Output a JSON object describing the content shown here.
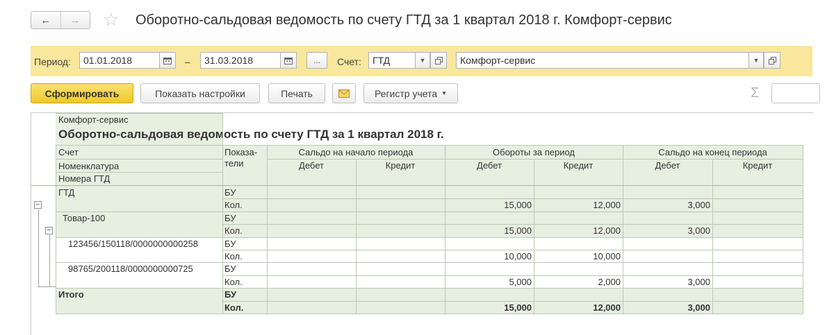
{
  "header": {
    "back_icon": "←",
    "forward_icon": "→",
    "star_icon": "☆",
    "title": "Оборотно-сальдовая ведомость по счету ГТД за 1 квартал 2018 г. Комфорт-сервис"
  },
  "params": {
    "period_label": "Период:",
    "date_from": "01.01.2018",
    "dash": "–",
    "date_to": "31.03.2018",
    "ellipsis": "...",
    "account_label": "Счет:",
    "account_value": "ГТД",
    "org_value": "Комфорт-сервис"
  },
  "toolbar": {
    "generate": "Сформировать",
    "show_settings": "Показать настройки",
    "print": "Печать",
    "register": "Регистр учета",
    "sigma": "Σ"
  },
  "report": {
    "org": "Комфорт-сервис",
    "title": "Оборотно-сальдовая ведомость по счету ГТД за 1 квартал 2018 г.",
    "head": {
      "account": "Счет",
      "nomenclature": "Номенклатура",
      "gtd_numbers": "Номера ГТД",
      "indicators_1": "Показа-",
      "indicators_2": "тели",
      "opening": "Сальдо на начало периода",
      "turnover": "Обороты за период",
      "closing": "Сальдо на конец периода",
      "debit": "Дебет",
      "credit": "Кредит"
    },
    "rows": [
      {
        "label": "ГТД",
        "ind": "БУ",
        "v": [
          "",
          "",
          "",
          "",
          "",
          ""
        ]
      },
      {
        "label": "",
        "ind": "Кол.",
        "v": [
          "",
          "",
          "15,000",
          "12,000",
          "3,000",
          ""
        ]
      },
      {
        "label": "Товар-100",
        "ind": "БУ",
        "v": [
          "",
          "",
          "",
          "",
          "",
          ""
        ]
      },
      {
        "label": "",
        "ind": "Кол.",
        "v": [
          "",
          "",
          "15,000",
          "12,000",
          "3,000",
          ""
        ]
      },
      {
        "label": "123456/150118/0000000000258",
        "ind": "БУ",
        "v": [
          "",
          "",
          "",
          "",
          "",
          ""
        ]
      },
      {
        "label": "",
        "ind": "Кол.",
        "v": [
          "",
          "",
          "10,000",
          "10,000",
          "",
          ""
        ]
      },
      {
        "label": "98765/200118/0000000000725",
        "ind": "БУ",
        "v": [
          "",
          "",
          "",
          "",
          "",
          ""
        ]
      },
      {
        "label": "",
        "ind": "Кол.",
        "v": [
          "",
          "",
          "5,000",
          "2,000",
          "3,000",
          ""
        ]
      },
      {
        "label": "Итого",
        "ind": "БУ",
        "v": [
          "",
          "",
          "",
          "",
          "",
          ""
        ]
      },
      {
        "label": "",
        "ind": "Кол.",
        "v": [
          "",
          "",
          "15,000",
          "12,000",
          "3,000",
          ""
        ]
      }
    ]
  }
}
